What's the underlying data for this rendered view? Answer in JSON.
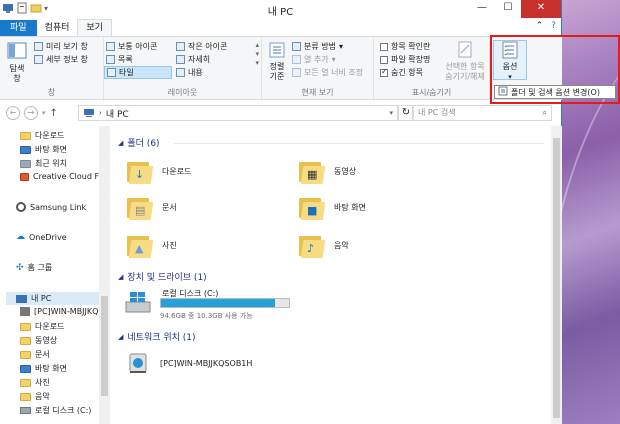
{
  "window": {
    "title": "내 PC"
  },
  "tabs": {
    "file": "파일",
    "computer": "컴퓨터",
    "view": "보기"
  },
  "ribbon": {
    "pane": {
      "nav_pane": "탐색\n창",
      "preview": "미리 보기 창",
      "details": "세부 정보 창",
      "label": "창"
    },
    "layout": {
      "normal_icons": "보통 아이콘",
      "small_icons": "작은 아이콘",
      "list": "목록",
      "details": "자세히",
      "tiles": "타일",
      "content": "내용",
      "label": "레이아웃"
    },
    "current_view": {
      "sort": "정렬\n기준",
      "group_by": "분류 방법",
      "add_columns": "열 추가",
      "fit_columns": "모든 열 너비 조정",
      "label": "현재 보기"
    },
    "show_hide": {
      "item_checkbox": "항목 확인란",
      "file_ext": "파일 확장명",
      "hidden_items": "숨긴 항목",
      "hide_selected": "선택한 항목\n숨기기/해제",
      "label": "표시/숨기기"
    },
    "options": {
      "label": "옵션"
    }
  },
  "popup": {
    "change_options": "폴더 및 검색 옵션 변경(O)"
  },
  "address": {
    "path": "내 PC",
    "search_placeholder": "내 PC 검색"
  },
  "nav_pane": {
    "items": [
      "다운로드",
      "바탕 화면",
      "최근 위치",
      "Creative Cloud Fi",
      "Samsung Link",
      "OneDrive",
      "홈 그룹",
      "내 PC",
      "[PC]WIN-MBJJKQ",
      "다운로드",
      "동영상",
      "문서",
      "바탕 화면",
      "사진",
      "음악",
      "로컬 디스크 (C:)"
    ]
  },
  "content": {
    "folders_header": "폴더 (6)",
    "folders": [
      "다운로드",
      "동영상",
      "문서",
      "바탕 화면",
      "사진",
      "음악"
    ],
    "devices_header": "장치 및 드라이브 (1)",
    "drive": {
      "name": "로컬 디스크 (C:)",
      "space": "94.6GB 중 10.3GB 사용 가능",
      "used_fraction": 0.89
    },
    "network_header": "네트워크 위치 (1)",
    "network_item": "[PC]WIN-MBJJKQSOB1H"
  },
  "colors": {
    "accent": "#1979ca",
    "close": "#c7302c",
    "highlight": "#e31b1b",
    "bar": "#26a0da"
  }
}
